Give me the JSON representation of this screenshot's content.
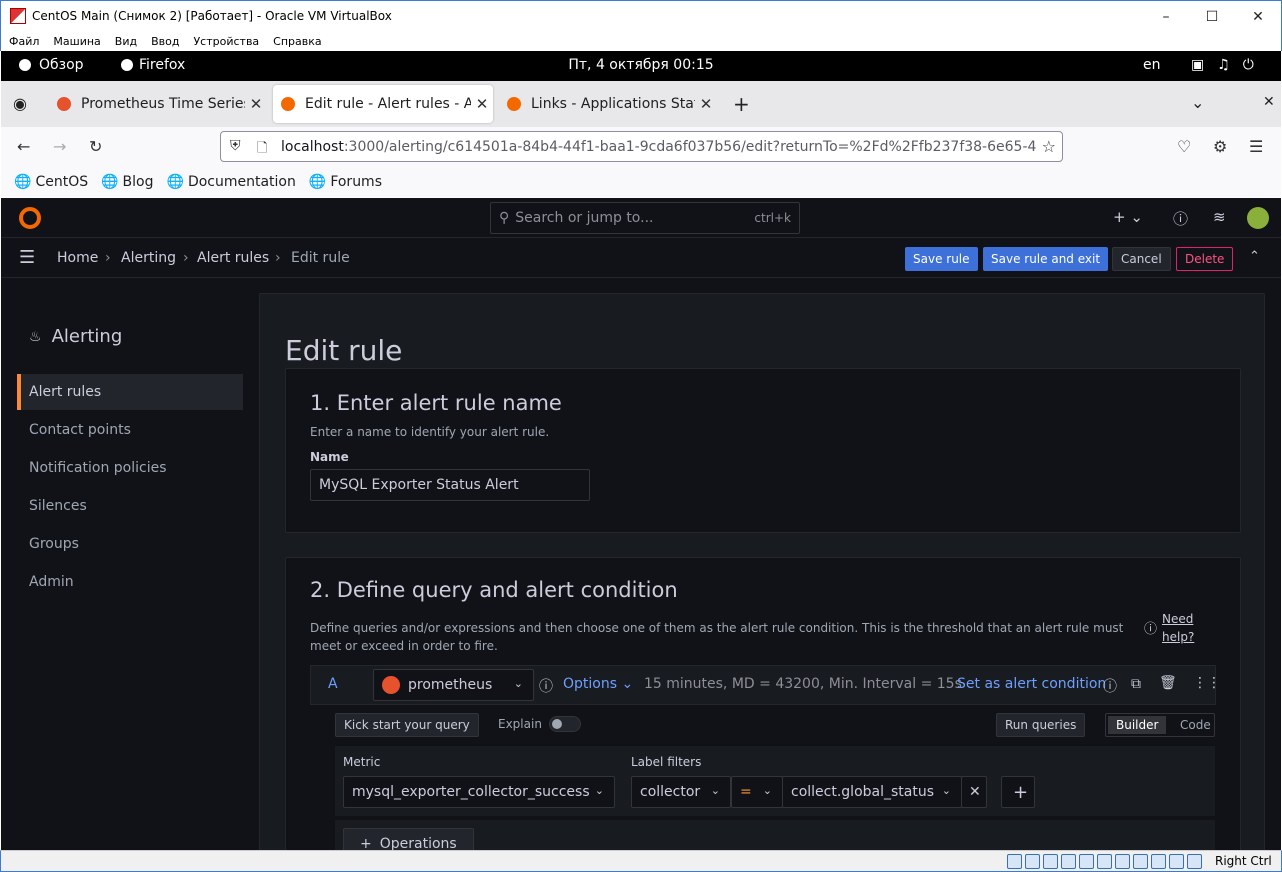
{
  "window": {
    "title": "CentOS Main (Снимок 2) [Работает] - Oracle VM VirtualBox"
  },
  "vbox_menu": [
    "Файл",
    "Машина",
    "Вид",
    "Ввод",
    "Устройства",
    "Справка"
  ],
  "gnome": {
    "overview": "Обзор",
    "app": "Firefox",
    "clock": "Пт, 4 октября  00:15",
    "lang": "en"
  },
  "tabs": [
    {
      "label": "Prometheus Time Series C",
      "icon_color": "#e6522c"
    },
    {
      "label": "Edit rule - Alert rules - Ale",
      "icon_color": "#f46800"
    },
    {
      "label": "Links - Applications Statu",
      "icon_color": "#f46800"
    }
  ],
  "url": {
    "host": "localhost",
    "path": ":3000/alerting/c614501a-84b4-44f1-baa1-9cda6f037b56/edit?returnTo=%2Fd%2Ffb237f38-6e65-4"
  },
  "bookmarks": [
    "CentOS",
    "Blog",
    "Documentation",
    "Forums"
  ],
  "grafana": {
    "search_placeholder": "Search or jump to...",
    "search_kbd": "ctrl+k",
    "breadcrumb": [
      "Home",
      "Alerting",
      "Alert rules",
      "Edit rule"
    ],
    "buttons": {
      "save": "Save rule",
      "save_exit": "Save rule and exit",
      "cancel": "Cancel",
      "delete": "Delete"
    },
    "sidebar": {
      "title": "Alerting",
      "items": [
        "Alert rules",
        "Contact points",
        "Notification policies",
        "Silences",
        "Groups",
        "Admin"
      ]
    },
    "page_title": "Edit rule",
    "section1": {
      "title": "1. Enter alert rule name",
      "desc": "Enter a name to identify your alert rule.",
      "name_label": "Name",
      "name_value": "MySQL Exporter Status Alert"
    },
    "section2": {
      "title": "2. Define query and alert condition",
      "desc": "Define queries and/or expressions and then choose one of them as the alert rule condition. This is the threshold that an alert rule must meet or exceed in order to fire.",
      "need_help": "Need help?",
      "query": {
        "ref": "A",
        "datasource": "prometheus",
        "options": "Options",
        "summary": "15 minutes, MD = 43200, Min. Interval = 15s",
        "set_condition": "Set as alert condition",
        "kickstart": "Kick start your query",
        "explain": "Explain",
        "run": "Run queries",
        "builder": "Builder",
        "code": "Code",
        "metric_label": "Metric",
        "metric_value": "mysql_exporter_collector_success",
        "label_filters": "Label filters",
        "filter_label": "collector",
        "filter_op": "=",
        "filter_value": "collect.global_status",
        "operations": "Operations"
      }
    }
  },
  "statusbar": {
    "host_key": "Right Ctrl"
  }
}
